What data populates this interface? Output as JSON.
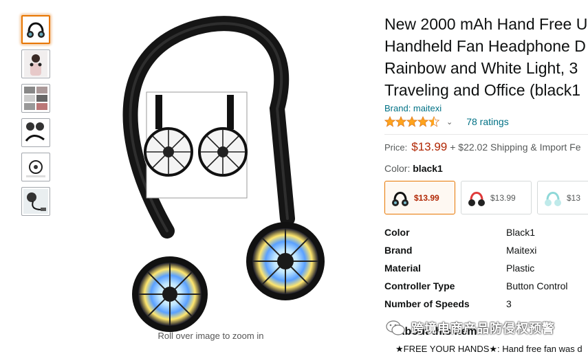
{
  "product": {
    "title_lines": [
      "New 2000 mAh Hand Free U",
      "Handheld Fan Headphone D",
      "Rainbow and White Light, 3",
      "Traveling and Office (black1"
    ],
    "brand": "Brand: maitexi",
    "rating_value": 4.5,
    "ratings_count": "78 ratings",
    "price_label": "Price:",
    "price": "$13.99",
    "shipping": "+ $22.02 Shipping & Import Fe"
  },
  "color_selector": {
    "label": "Color:",
    "selected": "black1",
    "swatches": [
      {
        "price": "$13.99",
        "color": "#222222",
        "accent": "#222222"
      },
      {
        "price": "$13.99",
        "color": "#e03a3a",
        "accent": "#222222"
      },
      {
        "price": "$13",
        "color": "#8ed8d8",
        "accent": "#8ed8d8"
      }
    ]
  },
  "specs": [
    {
      "key": "Color",
      "value": "Black1"
    },
    {
      "key": "Brand",
      "value": "Maitexi"
    },
    {
      "key": "Material",
      "value": "Plastic"
    },
    {
      "key": "Controller Type",
      "value": "Button Control"
    },
    {
      "key": "Number of Speeds",
      "value": "3"
    }
  ],
  "about": {
    "heading": "About this item",
    "bullet": "★FREE YOUR HANDS★: Hand free fan was d"
  },
  "gallery": {
    "zoom_hint": "Roll over image to zoom in",
    "thumbnail_count": 6
  },
  "watermark": "跨境电商产品防侵权预警",
  "colors": {
    "link": "#007185",
    "price": "#b12704",
    "star": "#ffa41c",
    "selected_border": "#e77600"
  }
}
